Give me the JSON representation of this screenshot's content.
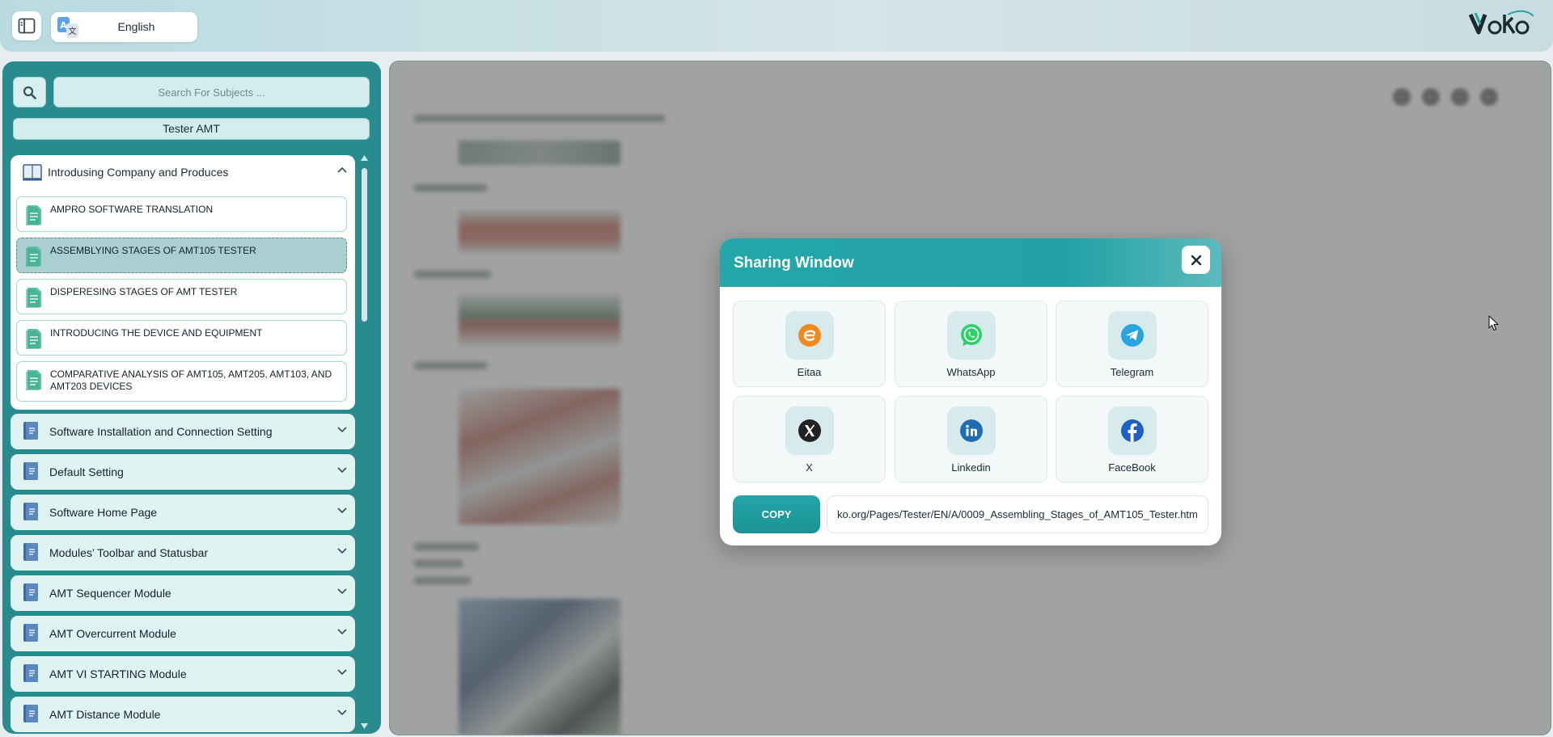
{
  "topbar": {
    "language": "English"
  },
  "sidebar": {
    "search_placeholder": "Search For Subjects ...",
    "subject": "Tester AMT",
    "open_group": {
      "label": "Introdusing Company and Produces",
      "lessons": [
        {
          "label": "AMPRO SOFTWARE TRANSLATION"
        },
        {
          "label": "ASSEMBLYING STAGES OF AMT105 TESTER",
          "active": true
        },
        {
          "label": "DISPERESING STAGES OF AMT TESTER"
        },
        {
          "label": "INTRODUCING THE DEVICE AND EQUIPMENT"
        },
        {
          "label": "COMPARATIVE ANALYSIS OF AMT105, AMT205, AMT103, AND AMT203 DEVICES"
        }
      ]
    },
    "groups": [
      {
        "label": "Software Installation and Connection Setting"
      },
      {
        "label": "Default Setting"
      },
      {
        "label": "Software Home Page"
      },
      {
        "label": "Modules’ Toolbar and Statusbar"
      },
      {
        "label": "AMT Sequencer Module"
      },
      {
        "label": "AMT Overcurrent Module"
      },
      {
        "label": "AMT VI STARTING Module"
      },
      {
        "label": "AMT Distance Module"
      }
    ]
  },
  "modal": {
    "title": "Sharing Window",
    "share_targets": [
      {
        "label": "Eitaa",
        "icon": "eitaa-icon",
        "color": "#f08a1c"
      },
      {
        "label": "WhatsApp",
        "icon": "whatsapp-icon",
        "color": "#25d366"
      },
      {
        "label": "Telegram",
        "icon": "telegram-icon",
        "color": "#2aa3e0"
      },
      {
        "label": "X",
        "icon": "x-icon",
        "color": "#222222"
      },
      {
        "label": "Linkedin",
        "icon": "linkedin-icon",
        "color": "#1f6db3"
      },
      {
        "label": "FaceBook",
        "icon": "facebook-icon",
        "color": "#1f5fc2"
      }
    ],
    "copy_label": "COPY",
    "url": "ko.org/Pages/Tester/EN/A/0009_Assembling_Stages_of_AMT105_Tester.htm"
  },
  "colors": {
    "sidebar_bg": "#2a8b8e",
    "accent": "#23a5a8",
    "overlay": "rgba(110,110,110,0.62)"
  }
}
